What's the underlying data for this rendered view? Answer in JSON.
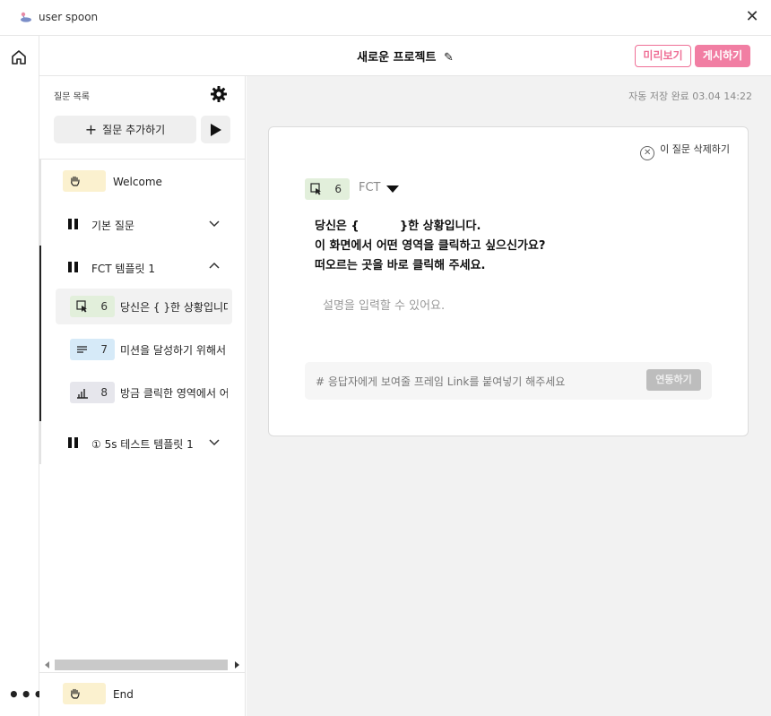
{
  "app": {
    "title": "user spoon"
  },
  "header": {
    "project_title": "새로운 프로젝트",
    "edit_glyph": "✎",
    "preview_label": "미리보기",
    "publish_label": "게시하기",
    "accent_color": "#f17ea3"
  },
  "sidebar": {
    "list_label": "질문 목록",
    "add_label": "질문 추가하기",
    "welcome_label": "Welcome",
    "end_label": "End",
    "groups": [
      {
        "label": "기본 질문",
        "expanded": false
      },
      {
        "label": "FCT 템플릿 1",
        "expanded": true
      },
      {
        "label": "① 5s 테스트 템플릿 1",
        "expanded": false
      }
    ],
    "questions": [
      {
        "num": "6",
        "text": "당신은 { }한 상황입니다.",
        "icon": "click-icon",
        "selected": true
      },
      {
        "num": "7",
        "text": "미션을 달성하기 위해서 어떻게 하시겠어요?",
        "icon": "text-lines-icon",
        "selected": false
      },
      {
        "num": "8",
        "text": "방금 클릭한 영역에서 어떤 점이 좋았나요?",
        "icon": "bar-chart-icon",
        "selected": false
      }
    ]
  },
  "main": {
    "autosave": "자동 저장 완료 03.04 14:22",
    "delete_label": "이 질문 삭제하기",
    "question_num": "6",
    "question_type": "FCT",
    "question_lines": [
      "당신은 {          }한 상황입니다.",
      "이 화면에서 어떤 영역을 클릭하고 싶으신가요?",
      "떠오르는 곳을 바로 클릭해 주세요."
    ],
    "description_placeholder": "설명을 입력할 수 있어요.",
    "link_placeholder": "# 응답자에게 보여줄 프레임 Link를 붙여넣기 해주세요",
    "link_button": "연동하기"
  }
}
